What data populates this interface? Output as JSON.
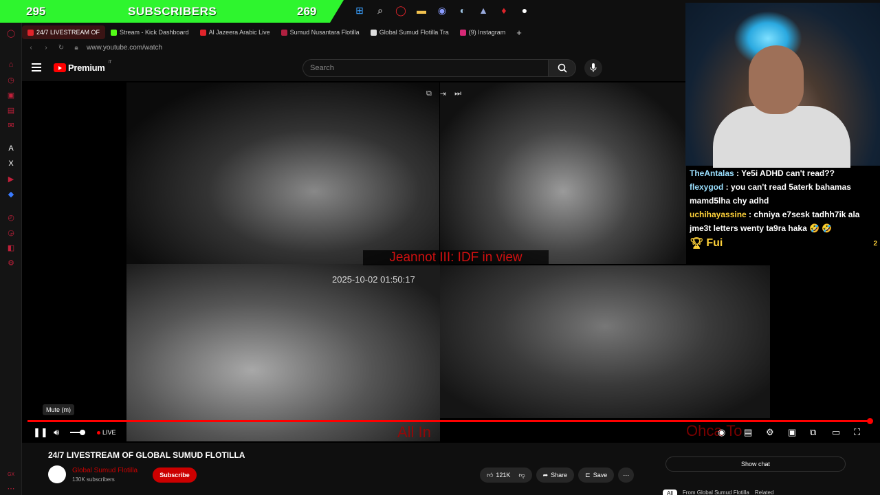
{
  "overlay": {
    "subs_left": "295",
    "subs_label": "SUBSCRIBERS",
    "subs_right": "269"
  },
  "tabs": [
    {
      "label": "24/7 LIVESTREAM OF",
      "color": "#e0242b"
    },
    {
      "label": "Stream - Kick Dashboard",
      "color": "#53fc18"
    },
    {
      "label": "Al Jazeera Arabic Live",
      "color": "#e0242b"
    },
    {
      "label": "Sumud Nusantara Flotilla",
      "color": "#b02040"
    },
    {
      "label": "Global Sumud Flotilla Tra",
      "color": "#dddddd"
    },
    {
      "label": "(9) Instagram",
      "color": "#d62976"
    }
  ],
  "url": "www.youtube.com/watch",
  "header": {
    "logo_text": "Premium",
    "logo_sup": "IT",
    "search_placeholder": "Search"
  },
  "video": {
    "banner": "Jeannot III: IDF in view",
    "timestamp": "2025-10-02 01:50:17",
    "tooltip": "Mute (m)",
    "live_label": "LIVE",
    "red_text_left": "All In",
    "red_text_right": "Ohca To"
  },
  "chat": {
    "messages": [
      {
        "user": "TheAntalas",
        "text": "Ye5i ADHD can't read??"
      },
      {
        "user": "flexygod",
        "text": "you can't read 5aterk bahamas mamd5lha chy adhd"
      },
      {
        "user": "uchihayassine",
        "text": "chniya e7sesk tadhh7ik ala jme3t letters wenty ta9ra haka 🤣 🤣"
      }
    ],
    "pinned_label": "Fui",
    "pinned_count": "2"
  },
  "below": {
    "title": "24/7 LIVESTREAM OF GLOBAL SUMUD FLOTILLA",
    "channel_name": "Global Sumud Flotilla",
    "channel_subs": "130K subscribers",
    "subscribe": "Subscribe",
    "likes": "121K",
    "share": "Share",
    "save": "Save",
    "show_chat": "Show chat",
    "chips": [
      "All",
      "From Global Sumud Flotilla",
      "Related"
    ]
  }
}
